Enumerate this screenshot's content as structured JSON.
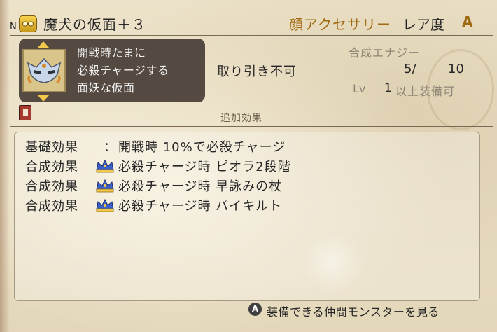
{
  "header": {
    "slot_marker": "N",
    "item_name": "魔犬の仮面＋３",
    "category": "顔アクセサリー",
    "rarity_label": "レア度",
    "rarity_value": "A"
  },
  "description": {
    "lines": [
      "開戦時たまに",
      "必殺チャージする",
      "面妖な仮面"
    ]
  },
  "stats": {
    "tradable": "取り引き不可",
    "synthesis_label": "合成エナジー",
    "synthesis_current": "5/",
    "synthesis_max": "10",
    "level_label": "Lv",
    "level_value": "1",
    "level_suffix": "以上装備可"
  },
  "extra_effects": {
    "title": "追加効果",
    "rows": [
      {
        "label": "基礎効果",
        "separator": "：",
        "text": "開戦時 10%で必殺チャージ"
      },
      {
        "label": "合成効果",
        "text": "必殺チャージ時 ピオラ2段階"
      },
      {
        "label": "合成効果",
        "text": "必殺チャージ時 早詠みの杖"
      },
      {
        "label": "合成効果",
        "text": "必殺チャージ時 バイキルト"
      }
    ]
  },
  "footer": {
    "button_glyph": "A",
    "action_text": "装備できる仲間モンスターを見る"
  },
  "colors": {
    "accent_gold": "#a06a10",
    "desc_bg": "#544a42",
    "crown_blue": "#3a5fc9",
    "crown_gold": "#f2c94c"
  },
  "icons": [
    "accessory-slot-icon",
    "mask-icon",
    "book-icon",
    "crown-icon",
    "a-button-icon"
  ]
}
